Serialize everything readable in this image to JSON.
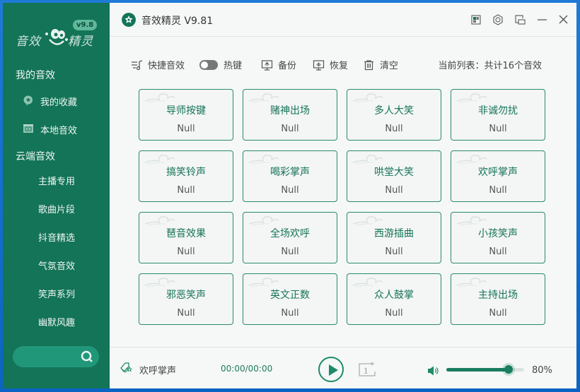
{
  "app": {
    "title": "音效精灵 V9.81",
    "logo_text_left": "音效",
    "logo_text_right": "精灵",
    "logo_version": "v9.8"
  },
  "window_controls": [
    {
      "name": "skin-button",
      "icon": "skin-icon"
    },
    {
      "name": "settings-button",
      "icon": "hexagon-settings-icon"
    },
    {
      "name": "mini-mode-button",
      "icon": "mini-window-icon"
    },
    {
      "name": "minimize-button",
      "icon": "minimize-icon"
    },
    {
      "name": "close-button",
      "icon": "close-icon"
    }
  ],
  "sidebar": {
    "my_section": "我的音效",
    "my_items": [
      {
        "label": "我的收藏",
        "icon": "favorite-star-icon"
      },
      {
        "label": "本地音效",
        "icon": "local-media-icon"
      }
    ],
    "cloud_section": "云端音效",
    "cloud_items": [
      "主播专用",
      "歌曲片段",
      "抖音精选",
      "气氛音效",
      "笑声系列",
      "幽默风趣"
    ],
    "search": {
      "value": "",
      "placeholder": "",
      "icon": "search-icon"
    }
  },
  "toolbar": {
    "quick_sound": "快捷音效",
    "hotkey": "热键",
    "hotkey_on": false,
    "backup": "备份",
    "restore": "恢复",
    "clear": "清空",
    "list_count": "当前列表：共计16个音效"
  },
  "sounds": [
    {
      "name": "导师按键",
      "key": "Null"
    },
    {
      "name": "赌神出场",
      "key": "Null"
    },
    {
      "name": "多人大笑",
      "key": "Null"
    },
    {
      "name": "非诚勿扰",
      "key": "Null"
    },
    {
      "name": "搞笑铃声",
      "key": "Null"
    },
    {
      "name": "喝彩掌声",
      "key": "Null"
    },
    {
      "name": "哄堂大笑",
      "key": "Null"
    },
    {
      "name": "欢呼掌声",
      "key": "Null"
    },
    {
      "name": "琶音效果",
      "key": "Null"
    },
    {
      "name": "全场欢呼",
      "key": "Null"
    },
    {
      "name": "西游插曲",
      "key": "Null"
    },
    {
      "name": "小孩笑声",
      "key": "Null"
    },
    {
      "name": "邪恶笑声",
      "key": "Null"
    },
    {
      "name": "英文正数",
      "key": "Null"
    },
    {
      "name": "众人鼓掌",
      "key": "Null"
    },
    {
      "name": "主持出场",
      "key": "Null"
    }
  ],
  "player": {
    "now_playing": "欢呼掌声",
    "time": "00:00/00:00",
    "loop_label": "1",
    "volume_percent": 80,
    "volume_text": "80%"
  },
  "colors": {
    "brand": "#137457",
    "accent": "#1e8a6a",
    "background": "#f5f8f7"
  }
}
